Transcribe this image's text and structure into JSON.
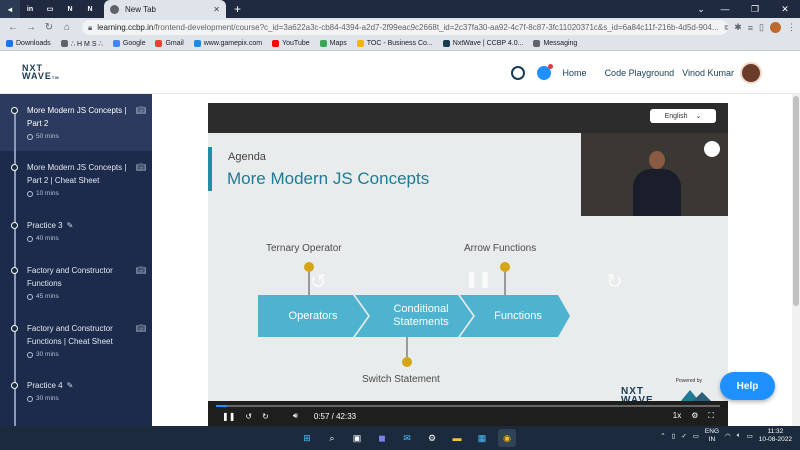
{
  "browser": {
    "pinned_tabs": [
      "◂",
      "in",
      "▭",
      "N",
      "N"
    ],
    "active_tab_title": "New Tab",
    "url_host": "learning.ccbp.in",
    "url_path": "/frontend-development/course?c_id=3a622a3c-cb84-4394-a2d7-2f99eac9c2668t_id=2c37fa30-aa92-4c7f-8c87-3fc11020371c&s_id=6a84c11f-216b-4d5d-904..."
  },
  "bookmarks": [
    {
      "label": "Downloads",
      "color": "#1a73e8"
    },
    {
      "label": "∴ H M S ∴",
      "color": "#5f6368"
    },
    {
      "label": "Google",
      "color": "#4285f4"
    },
    {
      "label": "Gmail",
      "color": "#ea4335"
    },
    {
      "label": "www.gamepix.com",
      "color": "#1e88e5"
    },
    {
      "label": "YouTube",
      "color": "#ff0000"
    },
    {
      "label": "Maps",
      "color": "#34a853"
    },
    {
      "label": "TOC - Business Co...",
      "color": "#f4b400"
    },
    {
      "label": "NxtWave | CCBP 4.0...",
      "color": "#183b56"
    },
    {
      "label": "Messaging",
      "color": "#5f6368"
    }
  ],
  "header": {
    "logo_line1": "NXT",
    "logo_line2": "WAVE",
    "logo_tm": "TM",
    "home": "Home",
    "code_playground": "Code Playground",
    "user_name": "Vinod Kumar"
  },
  "sidebar": {
    "items": [
      {
        "title": "More Modern JS Concepts | Part 2",
        "duration": "50 mins",
        "icon": "book",
        "active": true
      },
      {
        "title": "More Modern JS Concepts | Part 2 | Cheat Sheet",
        "duration": "10 mins",
        "icon": "book",
        "active": false
      },
      {
        "title": "Practice 3",
        "duration": "40 mins",
        "icon": "pencil",
        "active": false
      },
      {
        "title": "Factory and Constructor Functions",
        "duration": "45 mins",
        "icon": "book",
        "active": false
      },
      {
        "title": "Factory and Constructor Functions | Cheat Sheet",
        "duration": "30 mins",
        "icon": "book",
        "active": false
      },
      {
        "title": "Practice 4",
        "duration": "30 mins",
        "icon": "pencil",
        "active": false
      }
    ]
  },
  "video": {
    "language": "English",
    "slide_agenda": "Agenda",
    "slide_title": "More Modern JS Concepts",
    "label_ternary": "Ternary Operator",
    "label_arrow": "Arrow Functions",
    "label_switch": "Switch Statement",
    "step_operators": "Operators",
    "step_conditional": "Conditional Statements",
    "step_functions": "Functions",
    "powered_by": "Powered by",
    "logo_line1": "NXT",
    "logo_line2": "WAVE",
    "ibhubs": "IBHUBS",
    "current_time": "0:57",
    "duration": "42:33",
    "progress_fraction": 0.022,
    "speed": "1x"
  },
  "help_label": "Help",
  "taskbar": {
    "lang_line1": "ENG",
    "lang_line2": "IN",
    "time": "11:32",
    "date": "10-08-2022"
  }
}
